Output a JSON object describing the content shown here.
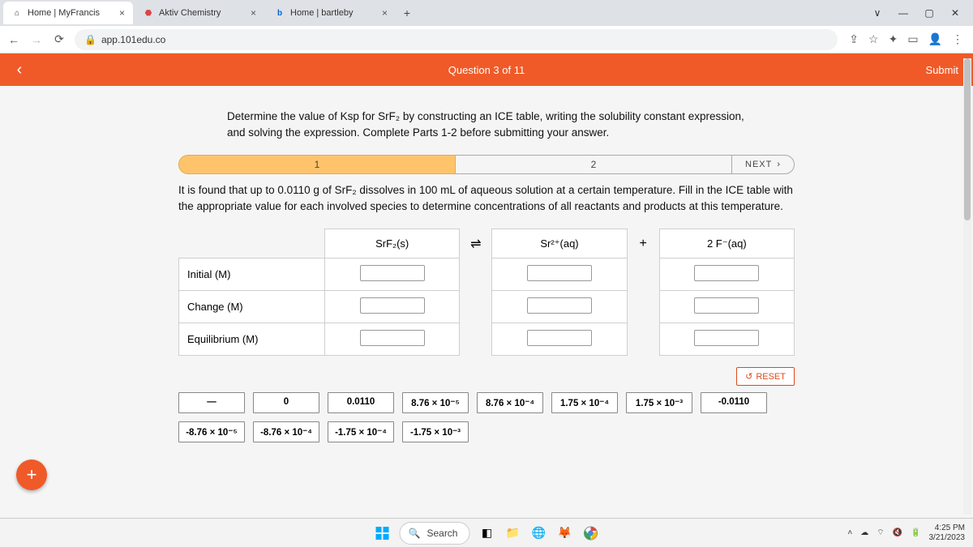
{
  "browser": {
    "tabs": [
      {
        "title": "Home | MyFrancis",
        "favicon": "⌂"
      },
      {
        "title": "Aktiv Chemistry",
        "favicon": "⬣"
      },
      {
        "title": "Home | bartleby",
        "favicon": "b"
      }
    ],
    "url": "app.101edu.co",
    "win": {
      "min": "—",
      "max": "▢",
      "close": "✕",
      "dropdown": "∨"
    }
  },
  "header": {
    "question_label": "Question 3 of 11",
    "submit_label": "Submit"
  },
  "instructions": "Determine the value of Ksp for SrF₂ by constructing an ICE table, writing the solubility constant expression, and solving the expression. Complete Parts 1-2 before submitting your answer.",
  "parts": {
    "p1": "1",
    "p2": "2",
    "next": "NEXT"
  },
  "problem": "It is found that up to 0.0110 g of SrF₂ dissolves in 100 mL of aqueous solution at a certain temperature. Fill in the ICE table with the appropriate value for each involved species to determine concentrations of all reactants and products at this temperature.",
  "ice": {
    "col1": "SrF₂(s)",
    "sep1": "⇌",
    "col2": "Sr²⁺(aq)",
    "sep2": "+",
    "col3": "2 F⁻(aq)",
    "rows": [
      "Initial (M)",
      "Change (M)",
      "Equilibrium (M)"
    ]
  },
  "reset_label": "RESET",
  "chips": [
    "—",
    "0",
    "0.0110",
    "8.76 × 10⁻⁵",
    "8.76 × 10⁻⁴",
    "1.75 × 10⁻⁴",
    "1.75 × 10⁻³",
    "-0.0110",
    "-8.76 × 10⁻⁵",
    "-8.76 × 10⁻⁴",
    "-1.75 × 10⁻⁴",
    "-1.75 × 10⁻³"
  ],
  "taskbar": {
    "search": "Search",
    "time": "4:25 PM",
    "date": "3/21/2023"
  }
}
